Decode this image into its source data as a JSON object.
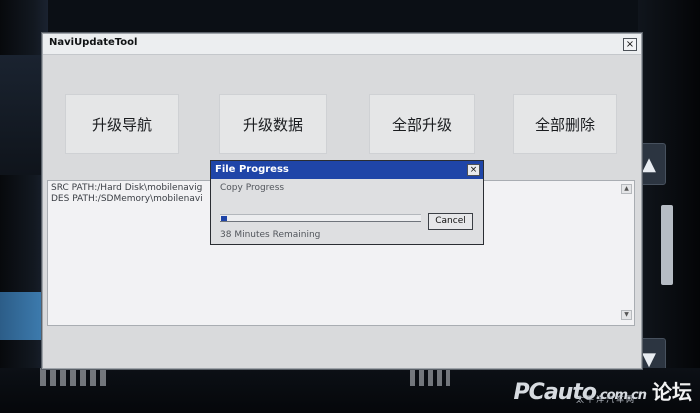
{
  "window": {
    "title": "NaviUpdateTool",
    "close_label": "×",
    "buttons": [
      "升级导航",
      "升级数据",
      "全部升级",
      "全部删除"
    ]
  },
  "log": {
    "lines": [
      "SRC PATH:/Hard Disk\\mobilenavig",
      "DES PATH:/SDMemory\\mobilenavi"
    ]
  },
  "dialog": {
    "title": "File Progress",
    "close_label": "×",
    "status": "Copy Progress",
    "progress_fraction": 0.03,
    "cancel_label": "Cancel",
    "remaining": "38 Minutes Remaining"
  },
  "side": {
    "up_icon": "triangle-up-icon",
    "down_icon": "triangle-down-icon",
    "up_glyph": "▲",
    "down_glyph": "▼"
  },
  "watermark": {
    "logo_text": "PCauto",
    "logo_sub": ".com.cn",
    "sub_text": "太平洋汽车网",
    "forum_text": "论坛"
  },
  "colors": {
    "dialog_titlebar": "#1f45a8",
    "progress_fill": "#1f45a8"
  }
}
